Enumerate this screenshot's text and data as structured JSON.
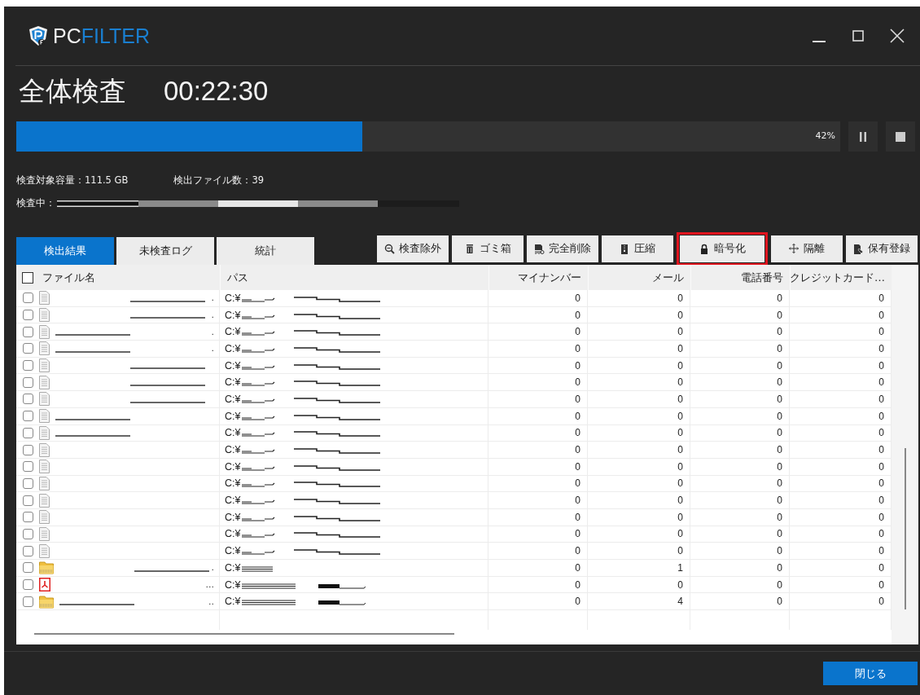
{
  "window": {
    "logo": [
      {
        "text": "PC",
        "kind": "plain"
      },
      {
        "text": "FILTER",
        "kind": "accent"
      }
    ]
  },
  "scan": {
    "title": "全体検査",
    "elapsed": "00:22:30",
    "level": 0.42,
    "percent": "42%",
    "capacity": "検査対象容量：111.5 GB",
    "found": "検出ファイル数：39",
    "current_label": "検査中："
  },
  "tabs": [
    {
      "label": "検出結果",
      "selected": true
    },
    {
      "label": "未検査ログ",
      "selected": false
    },
    {
      "label": "統計",
      "selected": false
    }
  ],
  "actions": [
    {
      "label": "検査除外",
      "highlighted": false
    },
    {
      "label": "ゴミ箱",
      "highlighted": false
    },
    {
      "label": "完全削除",
      "highlighted": false
    },
    {
      "label": "圧縮",
      "highlighted": false
    },
    {
      "label": "暗号化",
      "highlighted": true
    },
    {
      "label": "隔離",
      "highlighted": false
    },
    {
      "label": "保有登録",
      "highlighted": false
    }
  ],
  "table": {
    "all_checked": false,
    "columns": [
      "ファイル名",
      "パス",
      "マイナンバー",
      "メール",
      "電話番号",
      "クレジットカード…"
    ],
    "rows": [
      {
        "checked": false,
        "kind": "doc",
        "tail": ".",
        "path": "C:¥",
        "values": [
          "0",
          "0",
          "0",
          "0"
        ]
      },
      {
        "checked": false,
        "kind": "doc",
        "tail": ".",
        "path": "C:¥",
        "values": [
          "0",
          "0",
          "0",
          "0"
        ]
      },
      {
        "checked": false,
        "kind": "doc",
        "tail": ".",
        "path": "C:¥",
        "values": [
          "0",
          "0",
          "0",
          "0"
        ]
      },
      {
        "checked": false,
        "kind": "doc",
        "tail": ".",
        "path": "C:¥",
        "values": [
          "0",
          "0",
          "0",
          "0"
        ]
      },
      {
        "checked": false,
        "kind": "doc",
        "path": "C:¥",
        "values": [
          "0",
          "0",
          "0",
          "0"
        ]
      },
      {
        "checked": false,
        "kind": "doc",
        "path": "C:¥",
        "values": [
          "0",
          "0",
          "0",
          "0"
        ]
      },
      {
        "checked": false,
        "kind": "doc",
        "path": "C:¥",
        "values": [
          "0",
          "0",
          "0",
          "0"
        ]
      },
      {
        "checked": false,
        "kind": "doc",
        "path": "C:¥",
        "values": [
          "0",
          "0",
          "0",
          "0"
        ]
      },
      {
        "checked": false,
        "kind": "doc",
        "path": "C:¥",
        "values": [
          "0",
          "0",
          "0",
          "0"
        ]
      },
      {
        "checked": false,
        "kind": "doc",
        "path": "C:¥",
        "values": [
          "0",
          "0",
          "0",
          "0"
        ]
      },
      {
        "checked": false,
        "kind": "doc",
        "path": "C:¥",
        "values": [
          "0",
          "0",
          "0",
          "0"
        ]
      },
      {
        "checked": false,
        "kind": "doc",
        "path": "C:¥",
        "values": [
          "0",
          "0",
          "0",
          "0"
        ]
      },
      {
        "checked": false,
        "kind": "doc",
        "path": "C:¥",
        "values": [
          "0",
          "0",
          "0",
          "0"
        ]
      },
      {
        "checked": false,
        "kind": "doc",
        "path": "C:¥",
        "values": [
          "0",
          "0",
          "0",
          "0"
        ]
      },
      {
        "checked": false,
        "kind": "doc",
        "path": "C:¥",
        "values": [
          "0",
          "0",
          "0",
          "0"
        ]
      },
      {
        "checked": false,
        "kind": "doc",
        "path": "C:¥",
        "values": [
          "0",
          "0",
          "0",
          "0"
        ]
      },
      {
        "checked": false,
        "kind": "archive",
        "tail": ".",
        "path": "C:¥",
        "values": [
          "0",
          "1",
          "0",
          "0"
        ]
      },
      {
        "checked": false,
        "kind": "pdf",
        "tail": "...",
        "path": "C:¥",
        "values": [
          "0",
          "0",
          "0",
          "0"
        ]
      },
      {
        "checked": false,
        "kind": "archive",
        "tail": "..",
        "path": "C:¥",
        "values": [
          "0",
          "4",
          "0",
          "0"
        ]
      }
    ]
  },
  "footer": {
    "close_button": "閉じる"
  }
}
